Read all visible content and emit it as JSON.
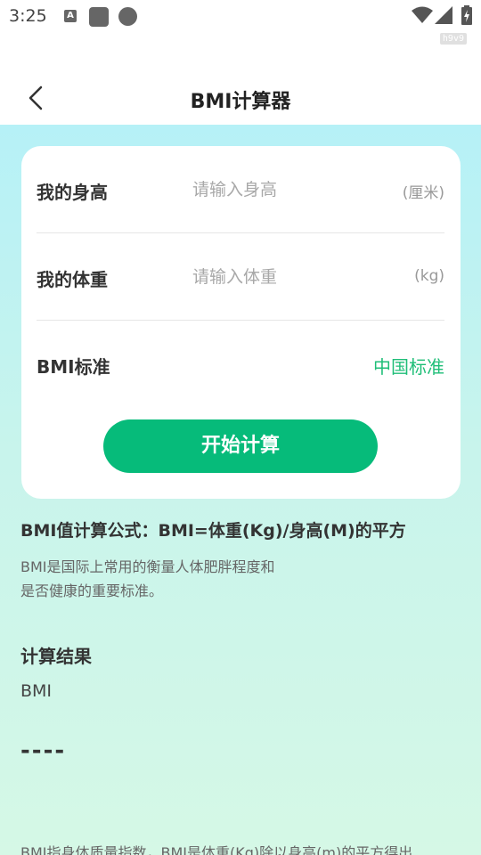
{
  "status_bar": {
    "time": "3:25",
    "badge": "h9v9",
    "icons": [
      "accessibility-icon",
      "square-icon",
      "circle-icon",
      "wifi-icon",
      "signal-icon",
      "battery-icon"
    ]
  },
  "nav": {
    "title": "BMI计算器",
    "back_icon": "chevron-left-icon"
  },
  "form": {
    "height": {
      "label": "我的身高",
      "placeholder": "请输入身高",
      "unit": "(厘米)",
      "value": ""
    },
    "weight": {
      "label": "我的体重",
      "placeholder": "请输入体重",
      "unit": "(kg)",
      "value": ""
    },
    "standard": {
      "label": "BMI标准",
      "value": "中国标准"
    },
    "submit_label": "开始计算"
  },
  "info": {
    "formula": "BMI值计算公式：BMI=体重(Kg)/身高(M)的平方",
    "description_line1": "BMI是国际上常用的衡量人体肥胖程度和",
    "description_line2": "是否健康的重要标准。"
  },
  "result": {
    "title": "计算结果",
    "label": "BMI",
    "value": "----"
  },
  "footer_note": "BMI指身体质量指数，BMI是体重(Kg)除以身高(m)的平方得出",
  "colors": {
    "accent": "#06bb7a",
    "accent_text": "#1fbe78",
    "gradient_top": "#b6f1f7",
    "gradient_bottom": "#d5f8e6"
  }
}
